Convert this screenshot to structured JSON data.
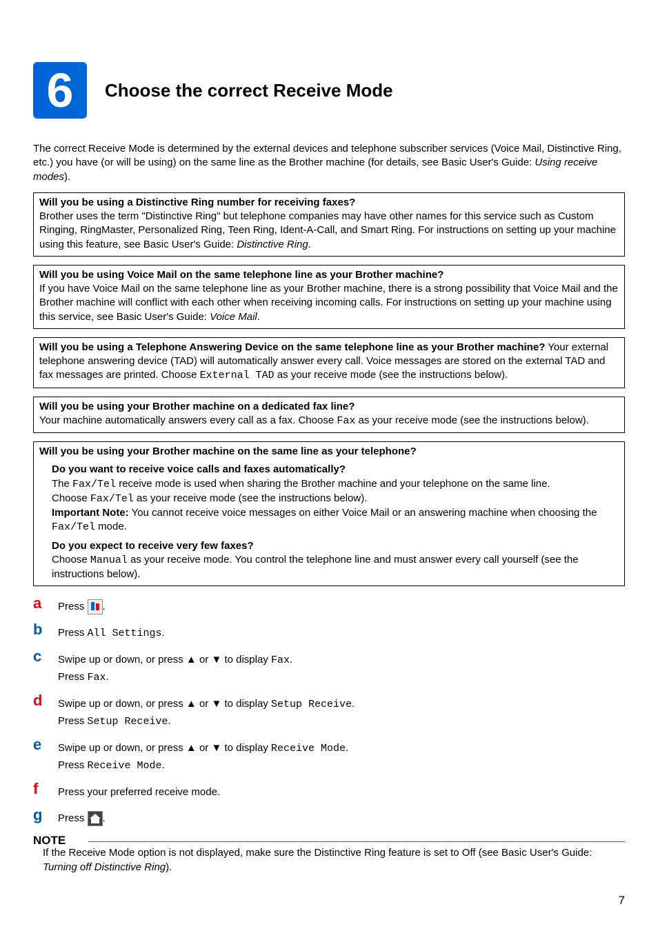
{
  "step_number": "6",
  "title": "Choose the correct Receive Mode",
  "intro_a": "The correct Receive Mode is determined by the external devices and telephone subscriber services (Voice Mail, Distinctive Ring, etc.) you have (or will be using) on the same line as the Brother machine (for details, see Basic User's Guide: ",
  "intro_ref": "Using receive modes",
  "intro_b": ").",
  "box1": {
    "q": "Will you be using a Distinctive Ring number for receiving faxes?",
    "body_a": "Brother uses the term \"Distinctive Ring\" but telephone companies may have other names for this service such as Custom Ringing, RingMaster, Personalized Ring, Teen Ring, Ident-A-Call, and Smart Ring. For instructions on setting up your machine using this feature, see Basic User's Guide: ",
    "body_ref": "Distinctive Ring",
    "body_b": "."
  },
  "box2": {
    "q": "Will you be using Voice Mail on the same telephone line as your Brother machine?",
    "body_a": "If you have Voice Mail on the same telephone line as your Brother machine, there is a strong possibility that Voice Mail and the Brother machine will conflict with each other when receiving incoming calls. For instructions on setting up your machine using this service, see Basic User's Guide: ",
    "body_ref": "Voice Mail",
    "body_b": "."
  },
  "box3": {
    "q": "Will you be using a Telephone Answering Device on the same telephone line as your Brother machine?",
    "body_a": "Your external telephone answering device (TAD) will automatically answer every call. Voice messages are stored on the external TAD and fax messages are printed. Choose ",
    "mode": "External TAD",
    "body_b": " as your receive mode (see the instructions below)."
  },
  "box4": {
    "q": "Will you be using your Brother machine on a dedicated fax line?",
    "body_a": "Your machine automatically answers every call as a fax. Choose ",
    "mode": "Fax",
    "body_b": " as your receive mode (see the instructions below)."
  },
  "box5": {
    "q": "Will you be using your Brother machine on the same line as your telephone?",
    "sub1": {
      "sq": "Do you want to receive voice calls and faxes automatically?",
      "l1a": "The ",
      "l1mode": "Fax/Tel",
      "l1b": " receive mode is used when sharing the Brother machine and your telephone on the same line.",
      "l2a": "Choose ",
      "l2mode": "Fax/Tel",
      "l2b": " as your receive mode (see the instructions below).",
      "note_label": "Important Note:",
      "note_a": " You cannot receive voice messages on either Voice Mail or an answering machine when choosing the ",
      "note_mode": "Fax/Tel",
      "note_b": " mode."
    },
    "sub2": {
      "sq": "Do you expect to receive very few faxes?",
      "l1a": "Choose ",
      "l1mode": "Manual",
      "l1b": " as your receive mode. You control the telephone line and must answer every call yourself (see the instructions below)."
    }
  },
  "steps": {
    "a": {
      "text": "Press ",
      "after": "."
    },
    "b": {
      "text": "Press ",
      "mono": "All Settings",
      "after": "."
    },
    "c": {
      "t1": "Swipe up or down, or press a or b to display ",
      "m1": "Fax",
      "t1b": ".",
      "t2": "Press ",
      "m2": "Fax",
      "t2b": "."
    },
    "d": {
      "t1": "Swipe up or down, or press a or b to display ",
      "m1": "Setup Receive",
      "t1b": ".",
      "t2": "Press ",
      "m2": "Setup Receive",
      "t2b": "."
    },
    "e": {
      "t1": "Swipe up or down, or press a or b to display ",
      "m1": "Receive Mode",
      "t1b": ".",
      "t2": "Press ",
      "m2": "Receive Mode",
      "t2b": "."
    },
    "f": {
      "text": "Press your preferred receive mode."
    },
    "g": {
      "text": "Press ",
      "after": "."
    }
  },
  "note": {
    "title": "NOTE",
    "body_a": "If the Receive Mode option is not displayed, make sure the Distinctive Ring feature is set to Off (see Basic User's Guide: ",
    "body_ref": "Turning off Distinctive Ring",
    "body_b": ")."
  },
  "page_number": "7"
}
